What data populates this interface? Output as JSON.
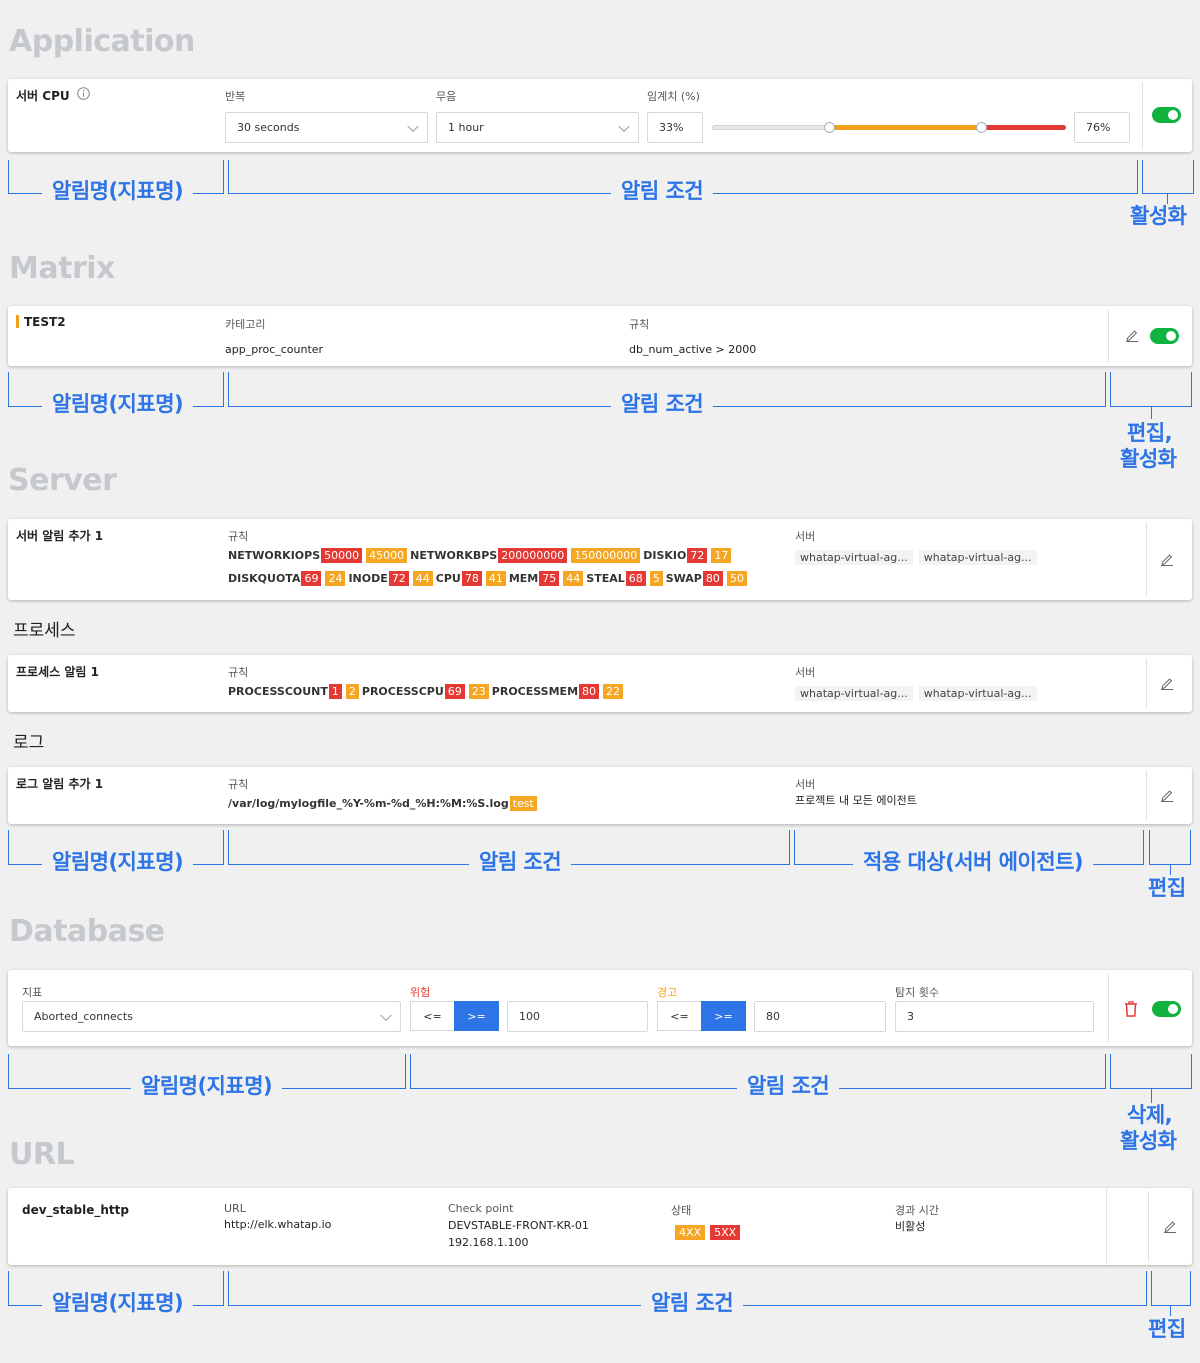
{
  "sections": {
    "application": "Application",
    "matrix": "Matrix",
    "server": "Server",
    "database": "Database",
    "url": "URL"
  },
  "subsections": {
    "process": "프로세스",
    "log": "로그"
  },
  "application": {
    "name": "서버 CPU",
    "repeat_label": "반복",
    "repeat_value": "30 seconds",
    "silence_label": "무음",
    "silence_value": "1 hour",
    "threshold_label": "임계치 (%)",
    "threshold_low": "33%",
    "threshold_high": "76%",
    "low_fraction": 0.33,
    "high_fraction": 0.76,
    "enabled": true
  },
  "matrix": {
    "name": "TEST2",
    "category_label": "카테고리",
    "category_value": "app_proc_counter",
    "rule_label": "규칙",
    "rule_value": "db_num_active > 2000",
    "enabled": true
  },
  "server": {
    "name": "서버 알림 추가 1",
    "rule_label": "규칙",
    "server_label": "서버",
    "rules_row1": [
      {
        "name": "NETWORKIOPS",
        "danger": "50000",
        "warning": "45000"
      },
      {
        "name": "NETWORKBPS",
        "danger": "200000000",
        "warning": "150000000"
      },
      {
        "name": "DISKIO",
        "danger": "72",
        "warning": "17"
      }
    ],
    "rules_row2": [
      {
        "name": "DISKQUOTA",
        "danger": "69",
        "warning": "24"
      },
      {
        "name": "INODE",
        "danger": "72",
        "warning": "44"
      },
      {
        "name": "CPU",
        "danger": "78",
        "warning": "41"
      },
      {
        "name": "MEM",
        "danger": "75",
        "warning": "44"
      },
      {
        "name": "STEAL",
        "danger": "68",
        "warning": "5"
      },
      {
        "name": "SWAP",
        "danger": "80",
        "warning": "50"
      }
    ],
    "servers": [
      "whatap-virtual-ag...",
      "whatap-virtual-ag..."
    ]
  },
  "process": {
    "name": "프로세스 알림 1",
    "rule_label": "규칙",
    "server_label": "서버",
    "rules": [
      {
        "name": "PROCESSCOUNT",
        "danger": "1",
        "warning": "2"
      },
      {
        "name": "PROCESSCPU",
        "danger": "69",
        "warning": "23"
      },
      {
        "name": "PROCESSMEM",
        "danger": "80",
        "warning": "22"
      }
    ],
    "servers": [
      "whatap-virtual-ag...",
      "whatap-virtual-ag..."
    ]
  },
  "log": {
    "name": "로그 알림 추가 1",
    "rule_label": "규칙",
    "rule_value": "/var/log/mylogfile_%Y-%m-%d_%H:%M:%S.log",
    "rule_tag": "test",
    "server_label": "서버",
    "server_value": "프로젝트 내 모든 에이전트"
  },
  "database": {
    "metric_label": "지표",
    "metric_value": "Aborted_connects",
    "danger_label": "위험",
    "warning_label": "경고",
    "op_lte": "<=",
    "op_gte": ">=",
    "danger_value": "100",
    "warning_value": "80",
    "detect_label": "탐지 횟수",
    "detect_value": "3",
    "enabled": true
  },
  "url": {
    "name": "dev_stable_http",
    "url_label": "URL",
    "url_value": "http://elk.whatap.io",
    "check_label": "Check point",
    "check_value1": "DEVSTABLE-FRONT-KR-01",
    "check_value2": "192.168.1.100",
    "status_label": "상태",
    "status_4xx": "4XX",
    "status_5xx": "5XX",
    "elapsed_label": "경과 시간",
    "elapsed_value": "비활성"
  },
  "annotations": {
    "alert_name": "알림명(지표명)",
    "alert_condition": "알림 조건",
    "activate": "활성화",
    "edit_activate_1": "편집,",
    "edit_activate_2": "활성화",
    "target": "적용 대상(서버 에이전트)",
    "edit": "편집",
    "delete_activate_1": "삭제,",
    "delete_activate_2": "활성화"
  },
  "colors": {
    "accent": "#2d74e6",
    "toggle_on": "#11b33f",
    "danger": "#e53935",
    "warning": "#f5a623",
    "slider_mid": "#f5a01a",
    "slider_high": "#e53935"
  },
  "icons": [
    "info-icon",
    "chevron-down-icon",
    "pencil-icon",
    "trash-icon"
  ]
}
